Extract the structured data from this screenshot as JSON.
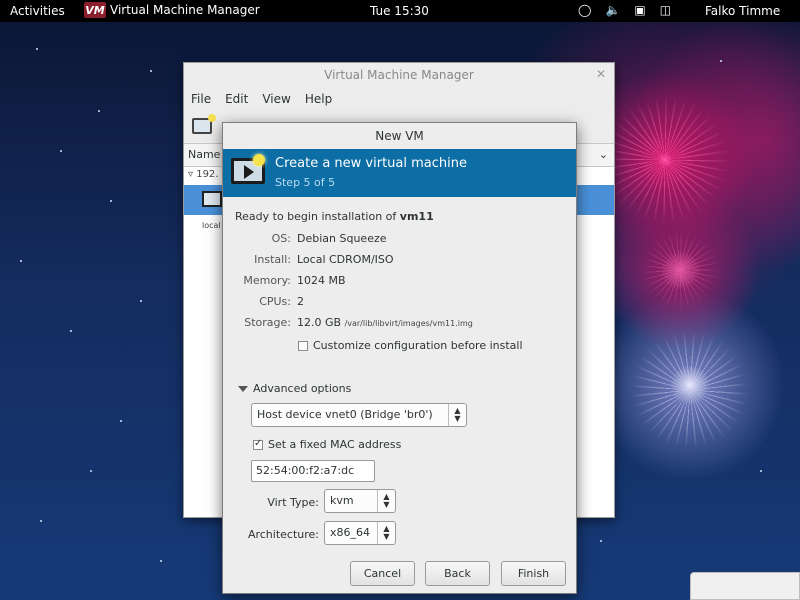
{
  "topbar": {
    "activities": "Activities",
    "app_name": "Virtual Machine Manager",
    "app_logo": "VM",
    "clock": "Tue 15:30",
    "user": "Falko Timme",
    "status_icons": [
      "accessibility-icon",
      "volume-icon",
      "network-icon",
      "battery-icon"
    ]
  },
  "back_window": {
    "title": "Virtual Machine Manager",
    "menu": [
      "File",
      "Edit",
      "View",
      "Help"
    ],
    "list_header": "Name",
    "group_label": "192.",
    "row_label": "local"
  },
  "dialog": {
    "title": "New VM",
    "banner_title": "Create a new virtual machine",
    "banner_step": "Step 5 of 5",
    "ready_prefix": "Ready to begin installation of ",
    "vm_name": "vm11",
    "summary": {
      "os_label": "OS:",
      "os_value": "Debian Squeeze",
      "install_label": "Install:",
      "install_value": "Local CDROM/ISO",
      "memory_label": "Memory:",
      "memory_value": "1024 MB",
      "cpus_label": "CPUs:",
      "cpus_value": "2",
      "storage_label": "Storage:",
      "storage_value": "12.0 GB",
      "storage_path": "/var/lib/libvirt/images/vm11.img"
    },
    "customize_label": "Customize configuration before install",
    "customize_checked": false,
    "advanced_label": "Advanced options",
    "network_device": "Host device vnet0 (Bridge 'br0')",
    "fixed_mac_label": "Set a fixed MAC address",
    "fixed_mac_checked": true,
    "mac_address": "52:54:00:f2:a7:dc",
    "virt_type_label": "Virt Type:",
    "virt_type_value": "kvm",
    "arch_label": "Architecture:",
    "arch_value": "x86_64",
    "buttons": {
      "cancel": "Cancel",
      "back": "Back",
      "finish": "Finish"
    }
  }
}
